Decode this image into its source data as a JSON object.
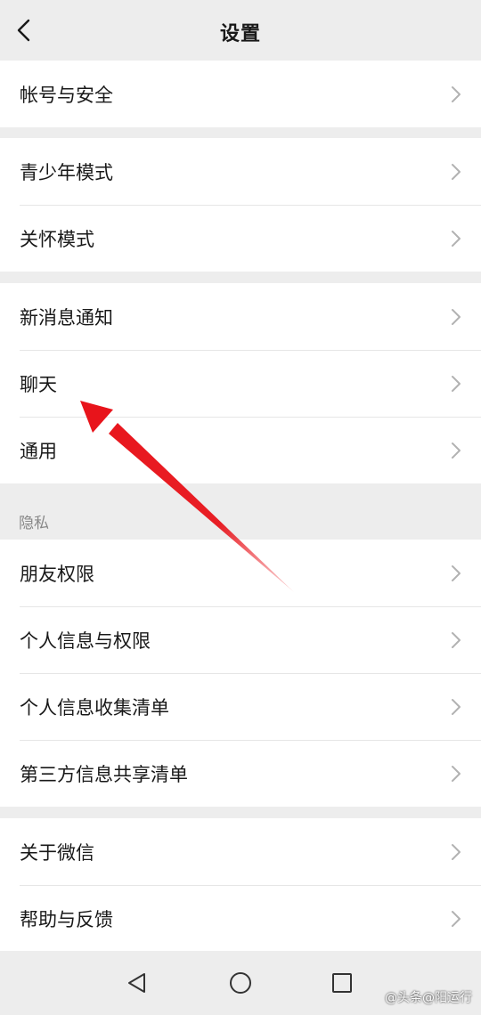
{
  "header": {
    "title": "设置"
  },
  "groups": [
    {
      "items": [
        {
          "label": "帐号与安全"
        }
      ]
    },
    {
      "items": [
        {
          "label": "青少年模式"
        },
        {
          "label": "关怀模式"
        }
      ]
    },
    {
      "items": [
        {
          "label": "新消息通知"
        },
        {
          "label": "聊天"
        },
        {
          "label": "通用"
        }
      ]
    },
    {
      "section_title": "隐私",
      "items": [
        {
          "label": "朋友权限"
        },
        {
          "label": "个人信息与权限"
        },
        {
          "label": "个人信息收集清单"
        },
        {
          "label": "第三方信息共享清单"
        }
      ]
    },
    {
      "items": [
        {
          "label": "关于微信"
        },
        {
          "label": "帮助与反馈"
        }
      ]
    }
  ],
  "watermark": "@头条@阳运行",
  "colors": {
    "annotation_arrow": "#e8141b",
    "background": "#ededed",
    "row": "#ffffff"
  },
  "icons": {
    "back": "chevron-left-icon",
    "row": "chevron-right-icon",
    "nav": [
      "nav-back-icon",
      "nav-home-icon",
      "nav-recents-icon"
    ]
  }
}
